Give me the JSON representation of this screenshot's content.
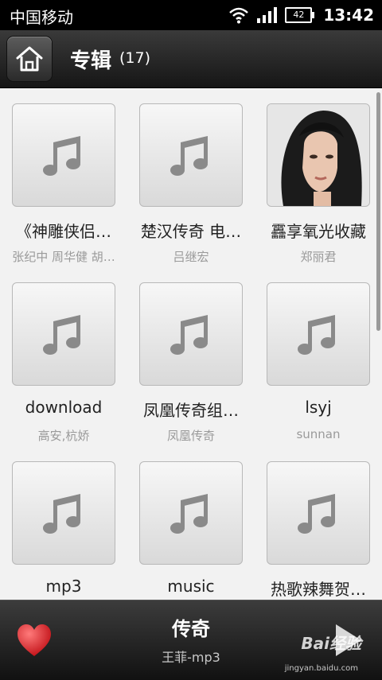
{
  "status_bar": {
    "carrier": "中国移动",
    "battery": "42",
    "time": "13:42"
  },
  "header": {
    "title": "专辑",
    "count": "(17)",
    "home_icon": "home-icon"
  },
  "albums": [
    {
      "name": "《神雕侠侣…",
      "artist": "张纪中 周华健 胡…",
      "cover": "music-note-icon"
    },
    {
      "name": "楚汉传奇 电…",
      "artist": "吕继宏",
      "cover": "music-note-icon"
    },
    {
      "name": "靐享氧光收藏",
      "artist": "郑丽君",
      "cover": "photo"
    },
    {
      "name": "download",
      "artist": "高安,杭娇",
      "cover": "music-note-icon"
    },
    {
      "name": "凤凰传奇组…",
      "artist": "凤凰传奇",
      "cover": "music-note-icon"
    },
    {
      "name": "lsyj",
      "artist": "sunnan",
      "cover": "music-note-icon"
    },
    {
      "name": "mp3",
      "artist": "",
      "cover": "music-note-icon"
    },
    {
      "name": "music",
      "artist": "",
      "cover": "music-note-icon"
    },
    {
      "name": "热歌辣舞贺…",
      "artist": "",
      "cover": "music-note-icon"
    }
  ],
  "now_playing": {
    "title": "传奇",
    "artist": "王菲-mp3",
    "favorite_icon": "heart-icon",
    "play_icon": "play-icon"
  },
  "watermark": {
    "brand": "Bai经验",
    "url": "jingyan.baidu.com"
  },
  "colors": {
    "background": "#f2f2f2",
    "bar_dark": "#1a1a1a",
    "heart": "#d8262c"
  }
}
